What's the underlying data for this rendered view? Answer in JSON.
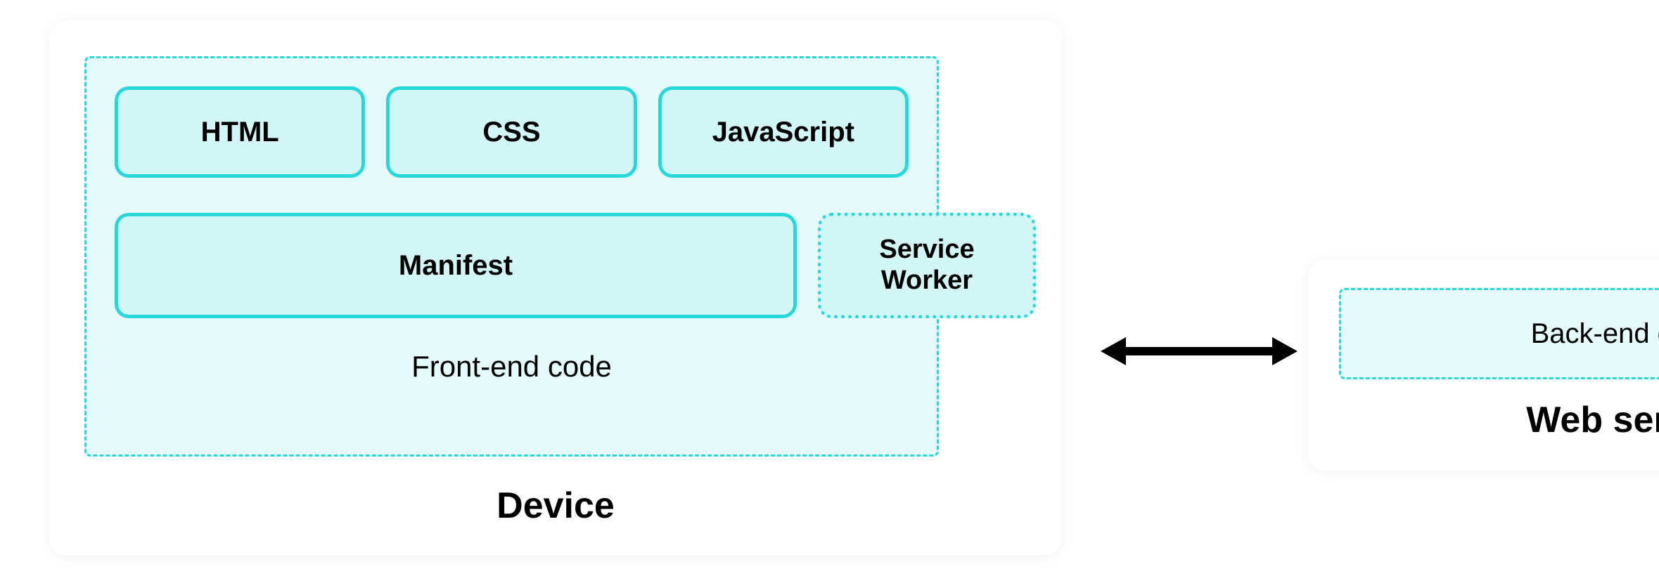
{
  "device": {
    "title": "Device",
    "frontend": {
      "label": "Front-end code",
      "techs": {
        "html": "HTML",
        "css": "CSS",
        "js": "JavaScript"
      },
      "manifest": "Manifest",
      "service_worker": "Service\nWorker"
    }
  },
  "server": {
    "title": "Web server",
    "backend_label": "Back-end code"
  }
}
